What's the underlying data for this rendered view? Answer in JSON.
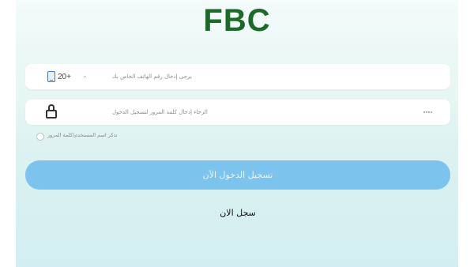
{
  "header": {
    "logo_text": "FBC"
  },
  "phone_field": {
    "country_code": "20+",
    "placeholder": "يرجى إدخال رقم الهاتف الخاص بك",
    "phone_icon": "phone-icon",
    "dropdown_icon": "chevron-down-icon"
  },
  "password_field": {
    "placeholder": "الرجاء إدخال كلمة المرور لتسجيل الدخول",
    "lock_icon": "lock-icon",
    "visibility_icon": "eye-closed-icon"
  },
  "remember": {
    "label": "تذكر اسم المستخدم/كلمة المرور",
    "checked": false
  },
  "login_button": {
    "label": "تسجيل الدخول الآن",
    "color": "#7cc3ee"
  },
  "register_button": {
    "label": "سجل الان"
  },
  "colors": {
    "logo": "#1b6a2a",
    "accent": "#7cc3ee"
  }
}
